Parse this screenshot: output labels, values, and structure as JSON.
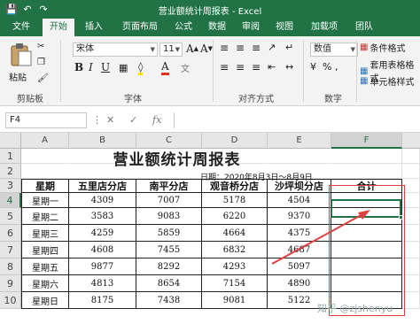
{
  "window": {
    "title": "营业额统计周报表 - Excel"
  },
  "tabs": [
    "文件",
    "开始",
    "插入",
    "页面布局",
    "公式",
    "数据",
    "审阅",
    "视图",
    "加载项",
    "团队"
  ],
  "ribbon": {
    "paste_label": "粘贴",
    "clipboard_label": "剪贴板",
    "font_name": "宋体",
    "font_size": "11",
    "font_label": "字体",
    "alignment_label": "对齐方式",
    "number_format": "数值",
    "number_label": "数字",
    "styles": [
      "条件格式",
      "套用表格格式",
      "单元格样式"
    ]
  },
  "formula_bar": {
    "name_box": "F4",
    "fx": "fx"
  },
  "columns": [
    "A",
    "B",
    "C",
    "D",
    "E",
    "F"
  ],
  "rows": [
    "1",
    "2",
    "3",
    "4",
    "5",
    "6",
    "7",
    "8",
    "9",
    "10"
  ],
  "sheet": {
    "title": "营业额统计周报表",
    "date": "日期：2020年8月3日～8月9日",
    "headers": [
      "星期",
      "五里店分店",
      "南平分店",
      "观音桥分店",
      "沙坪坝分店",
      "合计"
    ],
    "data": [
      [
        "星期一",
        "4309",
        "7007",
        "5178",
        "4504"
      ],
      [
        "星期二",
        "3583",
        "9083",
        "6220",
        "9370"
      ],
      [
        "星期三",
        "4259",
        "5859",
        "4664",
        "4375"
      ],
      [
        "星期四",
        "4608",
        "7455",
        "6832",
        "4687"
      ],
      [
        "星期五",
        "9877",
        "8292",
        "4293",
        "5097"
      ],
      [
        "星期六",
        "4813",
        "8654",
        "7154",
        "4890"
      ],
      [
        "星期日",
        "8175",
        "7438",
        "9081",
        "5122"
      ]
    ]
  },
  "watermark": "知乎 @zjshenyu",
  "colors": {
    "accent": "#217346",
    "annotation": "#e04040"
  }
}
